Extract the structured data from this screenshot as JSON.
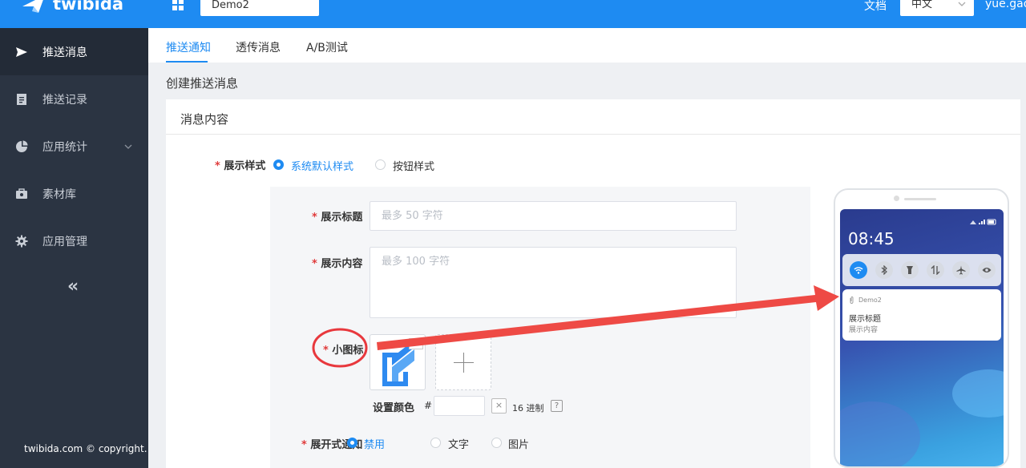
{
  "topbar": {
    "brand": "twibida",
    "app_name": "Demo2",
    "docs_label": "文档",
    "language": "中文",
    "user": "yue.gao"
  },
  "sidebar": {
    "items": [
      {
        "label": "推送消息",
        "icon": "send-icon"
      },
      {
        "label": "推送记录",
        "icon": "document-icon"
      },
      {
        "label": "应用统计",
        "icon": "pie-chart-icon"
      },
      {
        "label": "素材库",
        "icon": "toolbox-icon"
      },
      {
        "label": "应用管理",
        "icon": "gear-icon"
      }
    ],
    "collapse": "«",
    "copyright": "twibida.com © copyright."
  },
  "tabs": [
    {
      "label": "推送通知",
      "active": true
    },
    {
      "label": "透传消息",
      "active": false
    },
    {
      "label": "A/B测试",
      "active": false
    }
  ],
  "page_title": "创建推送消息",
  "card": {
    "title": "消息内容",
    "display_style": {
      "label": "展示样式",
      "options": [
        "系统默认样式",
        "按钮样式"
      ],
      "selected": "系统默认样式"
    },
    "title_field": {
      "label": "展示标题",
      "placeholder": "最多 50 字符"
    },
    "content_field": {
      "label": "展示内容",
      "placeholder": "最多 100 字符"
    },
    "small_icon": {
      "label": "小图标",
      "remove": "×"
    },
    "color": {
      "label": "设置颜色",
      "hash": "#",
      "clear": "×",
      "unit": "16 进制",
      "help": "?"
    },
    "expand": {
      "label": "展开式通知",
      "options": [
        "禁用",
        "文字",
        "图片"
      ],
      "selected": "禁用"
    }
  },
  "required_mark": "*",
  "preview": {
    "time": "08:45",
    "notification": {
      "app": "Demo2",
      "title": "展示标题",
      "body": "展示内容"
    }
  },
  "colors": {
    "accent": "#1e8bf2",
    "sidebar": "#2b3442",
    "annotation": "#e8383d"
  }
}
